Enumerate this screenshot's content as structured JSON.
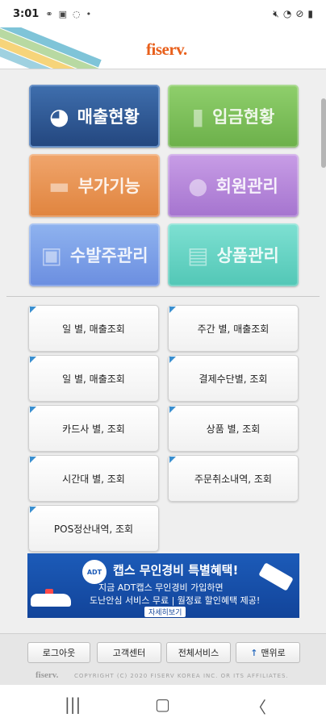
{
  "status_bar": {
    "time": "3:01",
    "icons_left": [
      "voicemail-icon",
      "gallery-icon",
      "sync-icon",
      "dot-icon"
    ],
    "icons_right": [
      "mute-icon",
      "wifi-icon",
      "dnd-icon",
      "battery-icon"
    ]
  },
  "header": {
    "logo": "fiserv."
  },
  "main_tiles": [
    {
      "label": "매출현황",
      "icon": "pie-chart-icon",
      "color": "#23467e"
    },
    {
      "label": "입금현황",
      "icon": "bar-chart-icon",
      "color": "#6cb04a"
    },
    {
      "label": "부가기능",
      "icon": "folder-icon",
      "color": "#e0843e"
    },
    {
      "label": "회원관리",
      "icon": "person-icon",
      "color": "#a574cf"
    },
    {
      "label": "수발주관리",
      "icon": "box-icon",
      "color": "#6b8ee0"
    },
    {
      "label": "상품관리",
      "icon": "document-icon",
      "color": "#52c7b6"
    }
  ],
  "sub_menu": [
    "일 별, 매출조회",
    "주간 별, 매출조회",
    "일 별, 매출조회",
    "결제수단별, 조회",
    "카드사 별, 조회",
    "상품 별, 조회",
    "시간대 별, 조회",
    "주문취소내역, 조회",
    "POS정산내역, 조회"
  ],
  "ad": {
    "brand": "ADT",
    "line1": "캡스 무인경비 특별혜택!",
    "line2": "지금 ADT캡스 무인경비 가입하면",
    "line3": "도난안심 서비스 무료 | 월정료 할인혜택 제공!",
    "more": "자세히보기"
  },
  "footer": {
    "buttons": [
      "로그아웃",
      "고객센터",
      "전체서비스",
      "맨위로"
    ],
    "logo": "fiserv.",
    "copyright": "COPYRIGHT (C) 2020 FISERV KOREA INC. OR ITS AFFILIATES."
  }
}
